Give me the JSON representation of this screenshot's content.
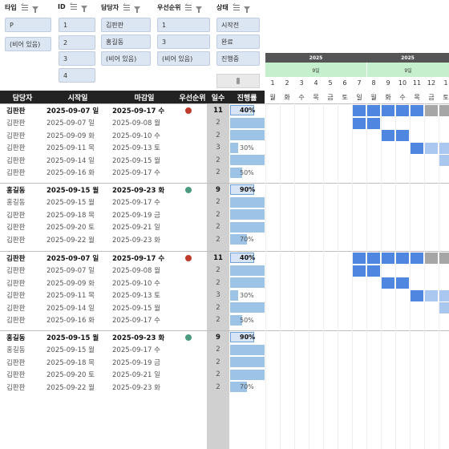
{
  "slicers": [
    {
      "title": "타입",
      "items": [
        "P",
        "(비어 있음)"
      ]
    },
    {
      "title": "ID",
      "items": [
        "1",
        "2",
        "3",
        "4"
      ]
    },
    {
      "title": "담당자",
      "items": [
        "김판판",
        "홍길동",
        "(비어 있음)"
      ]
    },
    {
      "title": "우선순위",
      "items": [
        "1",
        "3",
        "(비어 있음)"
      ]
    },
    {
      "title": "상태",
      "items": [
        "시작전",
        "완료",
        "진행중"
      ]
    }
  ],
  "table": {
    "headers": [
      "담당자",
      "시작일",
      "마감일",
      "우선순위",
      "일수",
      "진행률"
    ]
  },
  "colors": {
    "red_dot": "#c0392b",
    "green_dot": "#4a9a7f",
    "bar_dark": "#4f86e0",
    "bar_light": "#aac7f0",
    "bar_gray": "#a6a6a6"
  },
  "groups": [
    {
      "summary": {
        "name": "김판판",
        "start": "2025-09-07 일",
        "end": "2025-09-17 수",
        "prio": "red",
        "days": "11",
        "progress": "40%",
        "pct": 40
      },
      "tasks": [
        {
          "name": "김판판",
          "start": "2025-09-07 일",
          "end": "2025-09-08 월",
          "days": "2",
          "progress": "",
          "pct": 100
        },
        {
          "name": "김판판",
          "start": "2025-09-09 화",
          "end": "2025-09-10 수",
          "days": "2",
          "progress": "",
          "pct": 100
        },
        {
          "name": "김판판",
          "start": "2025-09-11 목",
          "end": "2025-09-13 토",
          "days": "3",
          "progress": "30%",
          "pct": 30
        },
        {
          "name": "김판판",
          "start": "2025-09-14 일",
          "end": "2025-09-15 월",
          "days": "2",
          "progress": "",
          "pct": 100
        },
        {
          "name": "김판판",
          "start": "2025-09-16 화",
          "end": "2025-09-17 수",
          "days": "2",
          "progress": "50%",
          "pct": 50
        }
      ]
    },
    {
      "summary": {
        "name": "홍길동",
        "start": "2025-09-15 월",
        "end": "2025-09-23 화",
        "prio": "green",
        "days": "9",
        "progress": "90%",
        "pct": 90
      },
      "tasks": [
        {
          "name": "홍길동",
          "start": "2025-09-15 월",
          "end": "2025-09-17 수",
          "days": "2",
          "progress": "",
          "pct": 100
        },
        {
          "name": "김판판",
          "start": "2025-09-18 목",
          "end": "2025-09-19 금",
          "days": "2",
          "progress": "",
          "pct": 100
        },
        {
          "name": "김판판",
          "start": "2025-09-20 토",
          "end": "2025-09-21 일",
          "days": "2",
          "progress": "",
          "pct": 100
        },
        {
          "name": "김판판",
          "start": "2025-09-22 월",
          "end": "2025-09-23 화",
          "days": "2",
          "progress": "70%",
          "pct": 70
        }
      ]
    },
    {
      "summary": {
        "name": "김판판",
        "start": "2025-09-07 일",
        "end": "2025-09-17 수",
        "prio": "red",
        "days": "11",
        "progress": "40%",
        "pct": 40
      },
      "tasks": [
        {
          "name": "김판판",
          "start": "2025-09-07 일",
          "end": "2025-09-08 월",
          "days": "2",
          "progress": "",
          "pct": 100
        },
        {
          "name": "김판판",
          "start": "2025-09-09 화",
          "end": "2025-09-10 수",
          "days": "2",
          "progress": "",
          "pct": 100
        },
        {
          "name": "김판판",
          "start": "2025-09-11 목",
          "end": "2025-09-13 토",
          "days": "3",
          "progress": "30%",
          "pct": 30
        },
        {
          "name": "김판판",
          "start": "2025-09-14 일",
          "end": "2025-09-15 월",
          "days": "2",
          "progress": "",
          "pct": 100
        },
        {
          "name": "김판판",
          "start": "2025-09-16 화",
          "end": "2025-09-17 수",
          "days": "2",
          "progress": "50%",
          "pct": 50
        }
      ]
    },
    {
      "summary": {
        "name": "홍길동",
        "start": "2025-09-15 월",
        "end": "2025-09-23 화",
        "prio": "green",
        "days": "9",
        "progress": "90%",
        "pct": 90
      },
      "tasks": [
        {
          "name": "홍길동",
          "start": "2025-09-15 월",
          "end": "2025-09-17 수",
          "days": "2",
          "progress": "",
          "pct": 100
        },
        {
          "name": "김판판",
          "start": "2025-09-18 목",
          "end": "2025-09-19 금",
          "days": "2",
          "progress": "",
          "pct": 100
        },
        {
          "name": "김판판",
          "start": "2025-09-20 토",
          "end": "2025-09-21 일",
          "days": "2",
          "progress": "",
          "pct": 100
        },
        {
          "name": "김판판",
          "start": "2025-09-22 월",
          "end": "2025-09-23 화",
          "days": "2",
          "progress": "70%",
          "pct": 70
        }
      ]
    }
  ],
  "gantt": {
    "months": [
      "2025",
      "2025"
    ],
    "weeks": [
      "9일",
      "9일"
    ],
    "days": [
      "1",
      "2",
      "3",
      "4",
      "5",
      "6",
      "7",
      "8",
      "9",
      "10",
      "11",
      "12",
      "1"
    ],
    "dows": [
      "월",
      "화",
      "수",
      "목",
      "금",
      "토",
      "일",
      "월",
      "화",
      "수",
      "목",
      "금",
      "토"
    ]
  }
}
